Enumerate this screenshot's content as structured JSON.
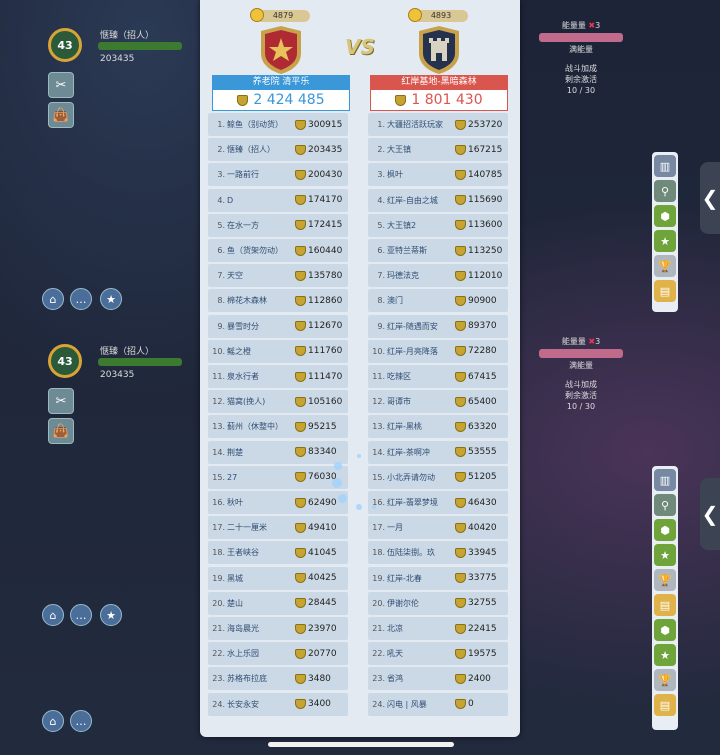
{
  "background_game": {
    "player_name": "惬臻（招人）",
    "player_level": "43",
    "player_score": "203435",
    "energy_label": "能量量",
    "energy_count": "3",
    "energy_status": "满能量",
    "battle_bonus_label": "战斗加成",
    "remaining_label": "剩余激活",
    "remaining_value": "10 / 30"
  },
  "match": {
    "left_team": {
      "coins": "4879",
      "name": "养老院 清平乐",
      "total": "2 424 485",
      "color": "#3a97d8"
    },
    "right_team": {
      "coins": "4893",
      "name": "红岸基地-黑暗森林",
      "total": "1 801 430",
      "color": "#d9564e"
    },
    "vs_label": "VS"
  },
  "left_rows": [
    {
      "rank": "1.",
      "name": "鲸鱼（别动货）",
      "score": "300915"
    },
    {
      "rank": "2.",
      "name": "惬臻（招人）",
      "score": "203435"
    },
    {
      "rank": "3.",
      "name": "一路前行",
      "score": "200430"
    },
    {
      "rank": "4.",
      "name": "D",
      "score": "174170"
    },
    {
      "rank": "5.",
      "name": "在水一方",
      "score": "172415"
    },
    {
      "rank": "6.",
      "name": "鱼（货架勿动）",
      "score": "160440"
    },
    {
      "rank": "7.",
      "name": "天空",
      "score": "135780"
    },
    {
      "rank": "8.",
      "name": "棉花木森林",
      "score": "112860"
    },
    {
      "rank": "9.",
      "name": "暴雪时分",
      "score": "112670"
    },
    {
      "rank": "10.",
      "name": "鳐之橙",
      "score": "111760"
    },
    {
      "rank": "11.",
      "name": "泉水行者",
      "score": "111470"
    },
    {
      "rank": "12.",
      "name": "猫窝(挽人)",
      "score": "105160"
    },
    {
      "rank": "13.",
      "name": "蓟州（休整中）",
      "score": "95215"
    },
    {
      "rank": "14.",
      "name": "荆楚",
      "score": "83340"
    },
    {
      "rank": "15.",
      "name": "27",
      "score": "76030"
    },
    {
      "rank": "16.",
      "name": "秋叶",
      "score": "62490"
    },
    {
      "rank": "17.",
      "name": "二十一厘米",
      "score": "49410"
    },
    {
      "rank": "18.",
      "name": "王者峡谷",
      "score": "41045"
    },
    {
      "rank": "19.",
      "name": "黑城",
      "score": "40425"
    },
    {
      "rank": "20.",
      "name": "楚山",
      "score": "28445"
    },
    {
      "rank": "21.",
      "name": "海岛晨光",
      "score": "23970"
    },
    {
      "rank": "22.",
      "name": "水上乐园",
      "score": "20770"
    },
    {
      "rank": "23.",
      "name": "苏格布拉底",
      "score": "3480"
    },
    {
      "rank": "24.",
      "name": "长安永安",
      "score": "3400"
    }
  ],
  "right_rows": [
    {
      "rank": "1.",
      "name": "大疆招活跃玩家",
      "score": "253720"
    },
    {
      "rank": "2.",
      "name": "大王镇",
      "score": "167215"
    },
    {
      "rank": "3.",
      "name": "枫叶",
      "score": "140785"
    },
    {
      "rank": "4.",
      "name": "红岸-自由之城",
      "score": "115690"
    },
    {
      "rank": "5.",
      "name": "大王镇2",
      "score": "113600"
    },
    {
      "rank": "6.",
      "name": "亚特兰蒂斯",
      "score": "113250"
    },
    {
      "rank": "7.",
      "name": "玛德法克",
      "score": "112010"
    },
    {
      "rank": "8.",
      "name": "澳门",
      "score": "90900"
    },
    {
      "rank": "9.",
      "name": "红岸-随遇而安",
      "score": "89370"
    },
    {
      "rank": "10.",
      "name": "红岸-月亮降落",
      "score": "72280"
    },
    {
      "rank": "11.",
      "name": "吃辣区",
      "score": "67415"
    },
    {
      "rank": "12.",
      "name": "哥谭市",
      "score": "65400"
    },
    {
      "rank": "13.",
      "name": "红岸-黑桃",
      "score": "63320"
    },
    {
      "rank": "14.",
      "name": "红岸-茶啊冲",
      "score": "53555"
    },
    {
      "rank": "15.",
      "name": "小北弄请勿动",
      "score": "51205"
    },
    {
      "rank": "16.",
      "name": "红岸-翡翠梦境",
      "score": "46430"
    },
    {
      "rank": "17.",
      "name": "一月",
      "score": "40420"
    },
    {
      "rank": "18.",
      "name": "伍陆柒捌。玖",
      "score": "33945"
    },
    {
      "rank": "19.",
      "name": "红岸-北春",
      "score": "33775"
    },
    {
      "rank": "20.",
      "name": "伊谢尔伦",
      "score": "32755"
    },
    {
      "rank": "21.",
      "name": "北凉",
      "score": "22415"
    },
    {
      "rank": "22.",
      "name": "吼天",
      "score": "19575"
    },
    {
      "rank": "23.",
      "name": "省鸿",
      "score": "2400"
    },
    {
      "rank": "24.",
      "name": "闪电 | 风暴",
      "score": "0"
    }
  ]
}
